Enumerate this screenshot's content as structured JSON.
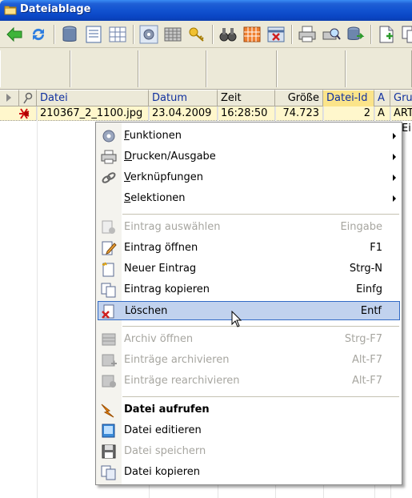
{
  "window": {
    "title": "Dateiablage"
  },
  "toolbar": {
    "buttons": [
      {
        "name": "back-arrow-icon"
      },
      {
        "name": "refresh-icon"
      },
      {
        "name": "database-icon"
      },
      {
        "name": "form-view-icon"
      },
      {
        "name": "table-view-icon"
      },
      {
        "name": "settings-icon"
      },
      {
        "name": "list-grid-icon"
      },
      {
        "name": "key-icon"
      },
      {
        "name": "binoculars-icon"
      },
      {
        "name": "calendar-icon"
      },
      {
        "name": "calendar-delete-icon"
      },
      {
        "name": "print-icon"
      },
      {
        "name": "print-preview-icon"
      },
      {
        "name": "export-icon"
      },
      {
        "name": "new-document-icon"
      },
      {
        "name": "copy-icon"
      }
    ]
  },
  "grid": {
    "columns": [
      {
        "label": ""
      },
      {
        "label": ""
      },
      {
        "label": "Datei"
      },
      {
        "label": "Datum"
      },
      {
        "label": "Zeit"
      },
      {
        "label": "Größe"
      },
      {
        "label": "Datei-Id"
      },
      {
        "label": "A"
      },
      {
        "label": "Gru"
      }
    ],
    "row": {
      "datei": "210367_2_1100.jpg",
      "datum": "23.04.2009",
      "zeit": "16:28:50",
      "groesse": "74.723",
      "datei_id": "2",
      "a": "A",
      "gruppe": "ART"
    },
    "row2_fragment": "Ein"
  },
  "context_menu": {
    "items": [
      {
        "id": "funktionen",
        "label_first": "F",
        "label_rest": "unktionen",
        "submenu": true,
        "enabled": true
      },
      {
        "id": "drucken",
        "label_first": "D",
        "label_rest": "rucken/Ausgabe",
        "submenu": true,
        "enabled": true
      },
      {
        "id": "verknuepfungen",
        "label_first": "V",
        "label_rest": "erknüpfungen",
        "submenu": true,
        "enabled": true
      },
      {
        "id": "selektionen",
        "label_first": "S",
        "label_rest": "elektionen",
        "submenu": true,
        "enabled": true
      },
      {
        "id": "eintrag-auswaehlen",
        "label": "Eintrag auswählen",
        "shortcut": "Eingabe",
        "enabled": false
      },
      {
        "id": "eintrag-oeffnen",
        "label": "Eintrag öffnen",
        "shortcut": "F1",
        "enabled": true
      },
      {
        "id": "neuer-eintrag",
        "label": "Neuer Eintrag",
        "shortcut": "Strg-N",
        "enabled": true
      },
      {
        "id": "eintrag-kopieren",
        "label": "Eintrag kopieren",
        "shortcut": "Einfg",
        "enabled": true
      },
      {
        "id": "loeschen",
        "label": "Löschen",
        "shortcut": "Entf",
        "enabled": true,
        "highlighted": true
      },
      {
        "id": "archiv-oeffnen",
        "label": "Archiv öffnen",
        "shortcut": "Strg-F7",
        "enabled": false
      },
      {
        "id": "eintraege-archivieren",
        "label": "Einträge archivieren",
        "shortcut": "Alt-F7",
        "enabled": false
      },
      {
        "id": "eintraege-rearchivieren",
        "label": "Einträge rearchivieren",
        "shortcut": "Alt-F7",
        "enabled": false
      },
      {
        "id": "datei-aufrufen",
        "label": "Datei aufrufen",
        "enabled": true,
        "bold": true
      },
      {
        "id": "datei-editieren",
        "label": "Datei editieren",
        "enabled": true
      },
      {
        "id": "datei-speichern",
        "label": "Datei speichern",
        "enabled": false
      },
      {
        "id": "datei-kopieren",
        "label": "Datei kopieren",
        "enabled": true
      }
    ]
  },
  "colors": {
    "titlebar": "#0a45c4",
    "menu_highlight": "#c1d2ee",
    "menu_highlight_border": "#316ac5",
    "row_selected": "#fff7cc",
    "sorted_column": "#fbe48a",
    "disabled_text": "#a7a6a0"
  }
}
